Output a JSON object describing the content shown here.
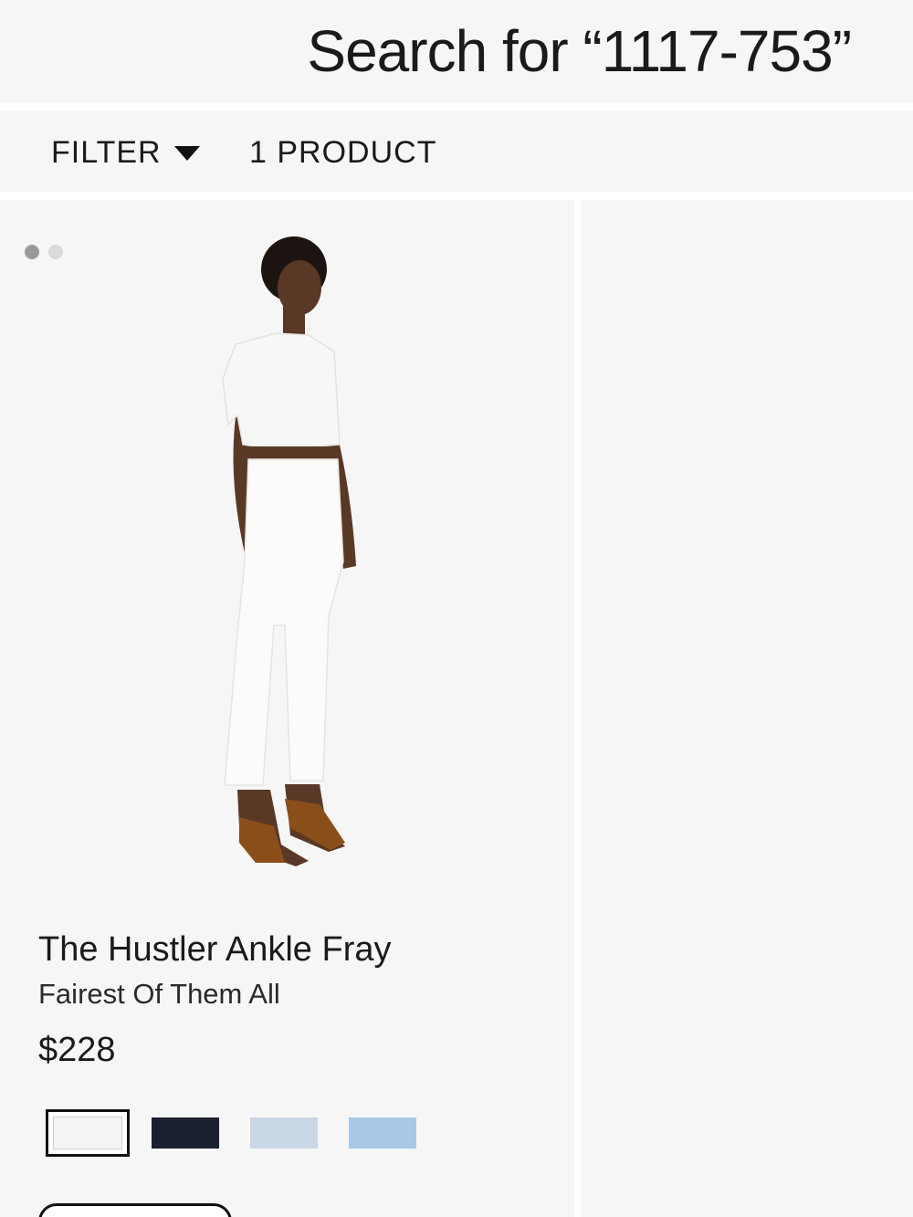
{
  "search": {
    "title": "Search for “1117-753”"
  },
  "toolbar": {
    "filter_label": "FILTER",
    "product_count": "1 PRODUCT"
  },
  "product": {
    "name": "The Hustler Ankle Fray",
    "color_name": "Fairest Of Them All",
    "price": "$228",
    "image_count": 2,
    "active_image_index": 0,
    "swatches": [
      {
        "color": "#f4f4f2",
        "selected": true
      },
      {
        "color": "#1b2030",
        "selected": false
      },
      {
        "color": "#c9d6e6",
        "selected": false
      },
      {
        "color": "#a8c8e8",
        "selected": false
      }
    ]
  },
  "colors": {
    "background": "#f6f6f6",
    "text": "#1a1a1a"
  }
}
